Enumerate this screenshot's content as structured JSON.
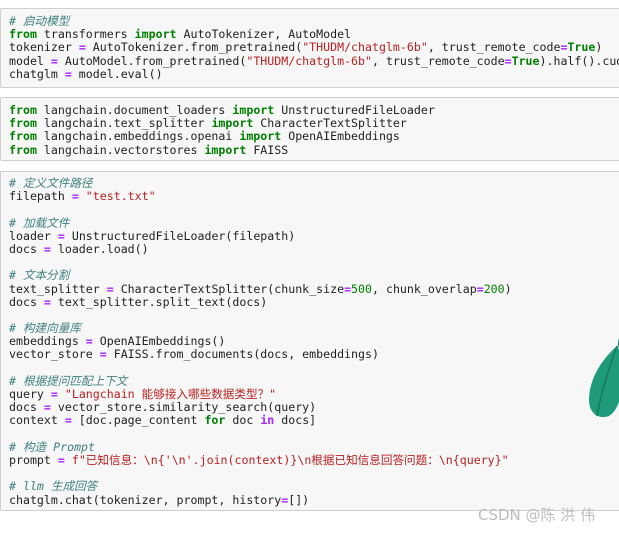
{
  "cells": [
    {
      "lines": [
        [
          {
            "t": "cm",
            "v": "# 启动模型"
          }
        ],
        [
          {
            "t": "kw",
            "v": "from"
          },
          {
            "t": "p",
            "v": " transformers "
          },
          {
            "t": "kw",
            "v": "import"
          },
          {
            "t": "p",
            "v": " AutoTokenizer, AutoModel"
          }
        ],
        [
          {
            "t": "p",
            "v": "tokenizer "
          },
          {
            "t": "op",
            "v": "="
          },
          {
            "t": "p",
            "v": " AutoTokenizer.from_pretrained("
          },
          {
            "t": "st",
            "v": "\"THUDM/chatglm-6b\""
          },
          {
            "t": "p",
            "v": ", trust_remote_code"
          },
          {
            "t": "op",
            "v": "="
          },
          {
            "t": "kw",
            "v": "True"
          },
          {
            "t": "p",
            "v": ")"
          }
        ],
        [
          {
            "t": "p",
            "v": "model "
          },
          {
            "t": "op",
            "v": "="
          },
          {
            "t": "p",
            "v": " AutoModel.from_pretrained("
          },
          {
            "t": "st",
            "v": "\"THUDM/chatglm-6b\""
          },
          {
            "t": "p",
            "v": ", trust_remote_code"
          },
          {
            "t": "op",
            "v": "="
          },
          {
            "t": "kw",
            "v": "True"
          },
          {
            "t": "p",
            "v": ").half().cuda()"
          }
        ],
        [
          {
            "t": "p",
            "v": "chatglm "
          },
          {
            "t": "op",
            "v": "="
          },
          {
            "t": "p",
            "v": " model.eval()"
          }
        ]
      ]
    },
    {
      "lines": [
        [
          {
            "t": "kw",
            "v": "from"
          },
          {
            "t": "p",
            "v": " langchain.document_loaders "
          },
          {
            "t": "kw",
            "v": "import"
          },
          {
            "t": "p",
            "v": " UnstructuredFileLoader"
          }
        ],
        [
          {
            "t": "kw",
            "v": "from"
          },
          {
            "t": "p",
            "v": " langchain.text_splitter "
          },
          {
            "t": "kw",
            "v": "import"
          },
          {
            "t": "p",
            "v": " CharacterTextSplitter"
          }
        ],
        [
          {
            "t": "kw",
            "v": "from"
          },
          {
            "t": "p",
            "v": " langchain.embeddings.openai "
          },
          {
            "t": "kw",
            "v": "import"
          },
          {
            "t": "p",
            "v": " OpenAIEmbeddings"
          }
        ],
        [
          {
            "t": "kw",
            "v": "from"
          },
          {
            "t": "p",
            "v": " langchain.vectorstores "
          },
          {
            "t": "kw",
            "v": "import"
          },
          {
            "t": "p",
            "v": " FAISS"
          }
        ]
      ]
    },
    {
      "lines": [
        [
          {
            "t": "cm",
            "v": "# 定义文件路径"
          }
        ],
        [
          {
            "t": "p",
            "v": "filepath "
          },
          {
            "t": "op",
            "v": "="
          },
          {
            "t": "p",
            "v": " "
          },
          {
            "t": "st",
            "v": "\"test.txt\""
          }
        ],
        [],
        [
          {
            "t": "cm",
            "v": "# 加载文件"
          }
        ],
        [
          {
            "t": "p",
            "v": "loader "
          },
          {
            "t": "op",
            "v": "="
          },
          {
            "t": "p",
            "v": " UnstructuredFileLoader(filepath)"
          }
        ],
        [
          {
            "t": "p",
            "v": "docs "
          },
          {
            "t": "op",
            "v": "="
          },
          {
            "t": "p",
            "v": " loader.load()"
          }
        ],
        [],
        [
          {
            "t": "cm",
            "v": "# 文本分割"
          }
        ],
        [
          {
            "t": "p",
            "v": "text_splitter "
          },
          {
            "t": "op",
            "v": "="
          },
          {
            "t": "p",
            "v": " CharacterTextSplitter(chunk_size"
          },
          {
            "t": "op",
            "v": "="
          },
          {
            "t": "nu",
            "v": "500"
          },
          {
            "t": "p",
            "v": ", chunk_overlap"
          },
          {
            "t": "op",
            "v": "="
          },
          {
            "t": "nu",
            "v": "200"
          },
          {
            "t": "p",
            "v": ")"
          }
        ],
        [
          {
            "t": "p",
            "v": "docs "
          },
          {
            "t": "op",
            "v": "="
          },
          {
            "t": "p",
            "v": " text_splitter.split_text(docs)"
          }
        ],
        [],
        [
          {
            "t": "cm",
            "v": "# 构建向量库"
          }
        ],
        [
          {
            "t": "p",
            "v": "embeddings "
          },
          {
            "t": "op",
            "v": "="
          },
          {
            "t": "p",
            "v": " OpenAIEmbeddings()"
          }
        ],
        [
          {
            "t": "p",
            "v": "vector_store "
          },
          {
            "t": "op",
            "v": "="
          },
          {
            "t": "p",
            "v": " FAISS.from_documents(docs, embeddings)"
          }
        ],
        [],
        [
          {
            "t": "cm",
            "v": "# 根据提问匹配上下文"
          }
        ],
        [
          {
            "t": "p",
            "v": "query "
          },
          {
            "t": "op",
            "v": "="
          },
          {
            "t": "p",
            "v": " "
          },
          {
            "t": "st",
            "v": "\"Langchain 能够接入哪些数据类型？\""
          }
        ],
        [
          {
            "t": "p",
            "v": "docs "
          },
          {
            "t": "op",
            "v": "="
          },
          {
            "t": "p",
            "v": " vector_store.similarity_search(query)"
          }
        ],
        [
          {
            "t": "p",
            "v": "context "
          },
          {
            "t": "op",
            "v": "="
          },
          {
            "t": "p",
            "v": " [doc.page_content "
          },
          {
            "t": "kw",
            "v": "for"
          },
          {
            "t": "p",
            "v": " doc "
          },
          {
            "t": "op",
            "v": "in"
          },
          {
            "t": "p",
            "v": " docs]"
          }
        ],
        [],
        [
          {
            "t": "cm",
            "v": "# 构造 Prompt"
          }
        ],
        [
          {
            "t": "p",
            "v": "prompt "
          },
          {
            "t": "op",
            "v": "="
          },
          {
            "t": "p",
            "v": " "
          },
          {
            "t": "st",
            "v": "f\"已知信息：\\n{'\\n'.join(context)}\\n根据已知信息回答问题：\\n{query}\""
          }
        ],
        [],
        [
          {
            "t": "cm",
            "v": "# llm 生成回答"
          }
        ],
        [
          {
            "t": "p",
            "v": "chatglm.chat(tokenizer, prompt, history"
          },
          {
            "t": "op",
            "v": "="
          },
          {
            "t": "p",
            "v": "[])"
          }
        ]
      ]
    }
  ],
  "watermark": "CSDN @陈 洪 伟",
  "colors": {
    "keyword": "#008000",
    "comment": "#408080",
    "string": "#ba2121",
    "number": "#008000",
    "operator": "#aa22ff",
    "cell_background": "#f7f7f7",
    "leaf": "#1f9a7b"
  }
}
